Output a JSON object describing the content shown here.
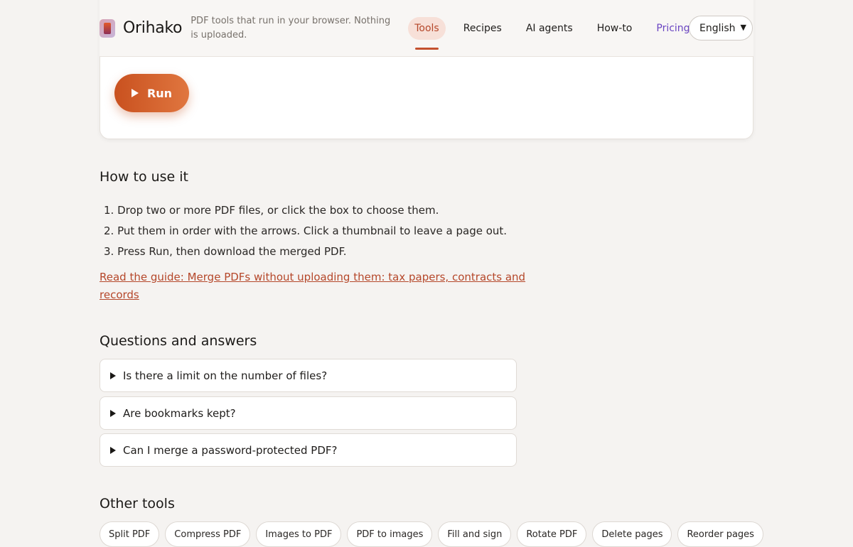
{
  "header": {
    "brand": "Orihako",
    "tagline": "PDF tools that run in your browser. Nothing is uploaded.",
    "nav": [
      "Tools",
      "Recipes",
      "AI agents",
      "How-to",
      "Pricing"
    ],
    "language": "English"
  },
  "tool": {
    "run_label": "Run"
  },
  "how_to": {
    "title": "How to use it",
    "steps": [
      "1. Drop two or more PDF files, or click the box to choose them.",
      "2. Put them in order with the arrows. Click a thumbnail to leave a page out.",
      "3. Press Run, then download the merged PDF."
    ],
    "guide_link": "Read the guide: Merge PDFs without uploading them: tax papers, contracts and records"
  },
  "faq": {
    "title": "Questions and answers",
    "items": [
      "Is there a limit on the number of files?",
      "Are bookmarks kept?",
      "Can I merge a password-protected PDF?"
    ]
  },
  "other_tools": {
    "title": "Other tools",
    "items": [
      "Split PDF",
      "Compress PDF",
      "Images to PDF",
      "PDF to images",
      "Fill and sign",
      "Rotate PDF",
      "Delete pages",
      "Reorder pages"
    ]
  },
  "colors": {
    "accent": "#c4512f",
    "pricing": "#6a45c2"
  }
}
